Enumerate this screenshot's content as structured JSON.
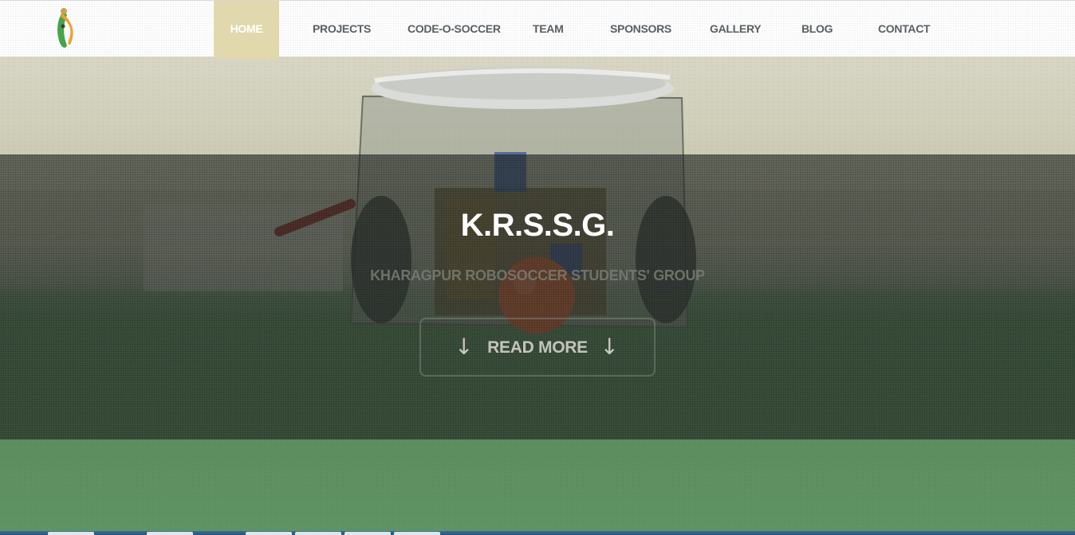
{
  "nav": {
    "items": [
      {
        "label": "HOME",
        "active": true
      },
      {
        "label": "PROJECTS",
        "active": false
      },
      {
        "label": "CODE-O-SOCCER",
        "active": false
      },
      {
        "label": "TEAM",
        "active": false
      },
      {
        "label": "SPONSORS",
        "active": false
      },
      {
        "label": "GALLERY",
        "active": false
      },
      {
        "label": "BLOG",
        "active": false
      },
      {
        "label": "CONTACT",
        "active": false
      }
    ]
  },
  "hero": {
    "title": "K.R.S.S.G.",
    "subtitle": "KHARAGPUR ROBOSOCCER STUDENTS' GROUP",
    "cta_label": "READ MORE",
    "cta_arrow": "↓"
  },
  "colors": {
    "active_tab": "#e2d8ad",
    "nav_text": "#5a5f63",
    "overlay": "#232823",
    "hero_text": "#ffffff"
  },
  "icons": [
    "logo-icon",
    "arrow-down-icon"
  ]
}
